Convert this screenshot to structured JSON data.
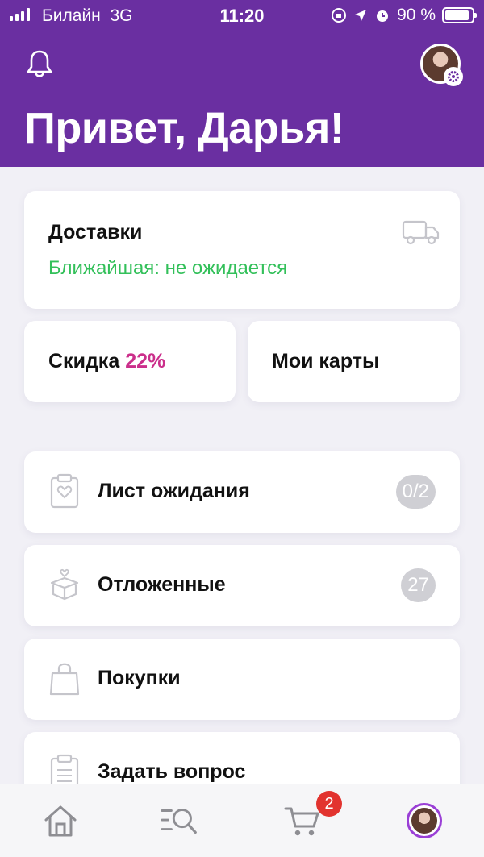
{
  "status_bar": {
    "carrier": "Билайн",
    "network": "3G",
    "time": "11:20",
    "battery_text": "90 %",
    "battery_level": 0.9
  },
  "header": {
    "greeting": "Привет, Дарья!",
    "bell_icon": "bell-icon",
    "settings_icon": "gear-icon"
  },
  "deliveries": {
    "title": "Доставки",
    "subtitle": "Ближайшая: не ожидается",
    "icon": "truck-icon"
  },
  "discount": {
    "label": "Скидка",
    "value": "22%"
  },
  "my_cards": {
    "label": "Мои карты"
  },
  "menu": [
    {
      "label": "Лист ожидания",
      "badge": "0/2",
      "icon": "clipboard-heart-icon"
    },
    {
      "label": "Отложенные",
      "badge": "27",
      "icon": "box-heart-icon"
    },
    {
      "label": "Покупки",
      "badge": "",
      "icon": "shopping-bag-icon"
    },
    {
      "label": "Задать вопрос",
      "badge": "",
      "icon": "clipboard-icon"
    }
  ],
  "tabbar": {
    "cart_badge": "2",
    "tabs": [
      "home-icon",
      "catalog-search-icon",
      "cart-icon",
      "profile-avatar"
    ]
  },
  "colors": {
    "brand_purple": "#6a2fa1",
    "discount_pink": "#cb2f8b",
    "status_green": "#33c05a",
    "badge_gray": "#cfcfd4",
    "cart_badge_red": "#e2332f"
  }
}
